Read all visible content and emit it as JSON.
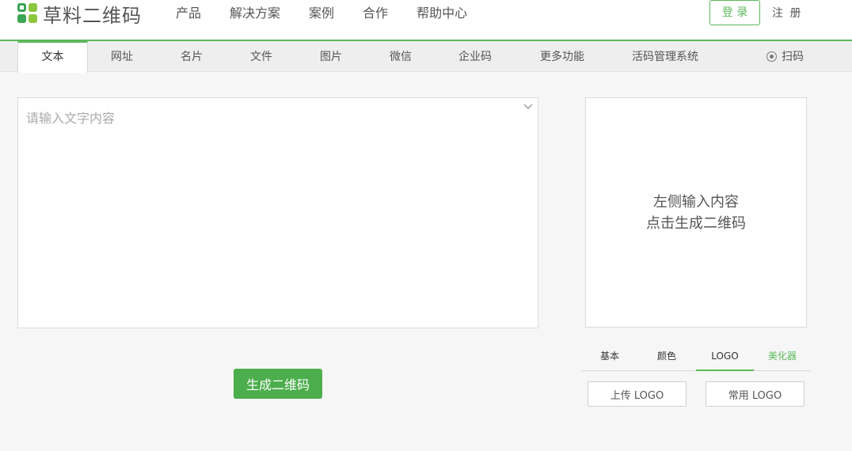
{
  "brand": {
    "name": "草料二维码"
  },
  "nav": {
    "items": [
      "产品",
      "解决方案",
      "案例",
      "合作",
      "帮助中心"
    ]
  },
  "account": {
    "login": "登 录",
    "register": "注 册"
  },
  "tabs": [
    "文本",
    "网址",
    "名片",
    "文件",
    "图片",
    "微信",
    "企业码",
    "更多功能",
    "活码管理系统"
  ],
  "active_tab": "文本",
  "scan": {
    "label": "扫码",
    "icon": "scan-icon"
  },
  "editor": {
    "placeholder": "请输入文字内容",
    "value": ""
  },
  "generate_button": "生成二维码",
  "preview": {
    "line1": "左侧输入内容",
    "line2": "点击生成二维码"
  },
  "style_tabs": [
    "基本",
    "颜色",
    "LOGO",
    "美化器"
  ],
  "active_style_tab": "LOGO",
  "logo_buttons": {
    "upload": "上传 LOGO",
    "common": "常用 LOGO"
  },
  "colors": {
    "accent": "#5cb85c",
    "button": "#4cae4c"
  }
}
